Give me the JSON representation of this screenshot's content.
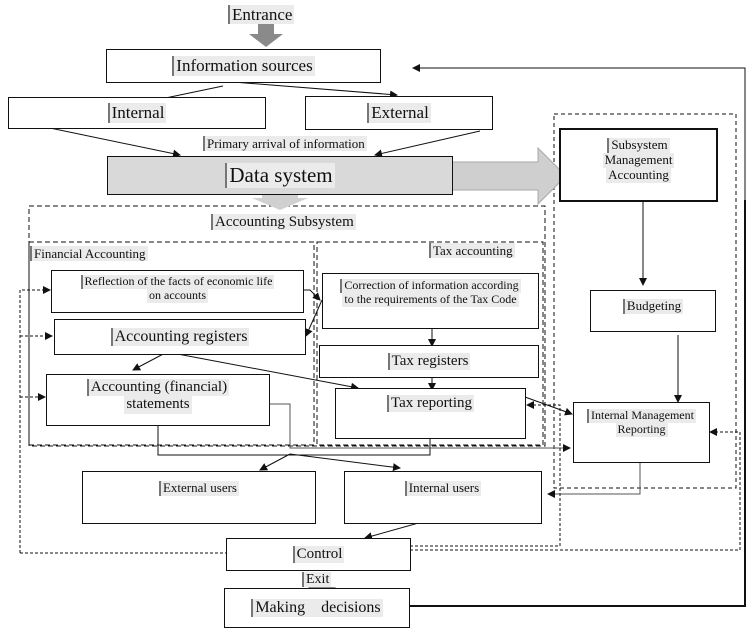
{
  "diagram": {
    "entrance": "Entrance",
    "information_sources": "Information sources",
    "internal": "Internal",
    "external": "External",
    "primary_arrival": "Primary arrival of information",
    "data_system": "Data system",
    "management_subsystem": [
      "Subsystem",
      "Management",
      "Accounting"
    ],
    "accounting_subsystem": "Accounting Subsystem",
    "financial_accounting": "Financial  Accounting",
    "tax_accounting": "Tax  accounting",
    "reflection": [
      "Reflection of the facts of economic life",
      "on accounts"
    ],
    "accounting_registers": "Accounting registers",
    "accounting_statements": [
      "Accounting (financial)",
      "statements"
    ],
    "correction": [
      "Correction of information according",
      "to the requirements of the Tax Code"
    ],
    "tax_registers": "Tax  registers",
    "tax_reporting": "Tax  reporting",
    "budgeting": "Budgeting",
    "internal_management_reporting": [
      "Internal Management",
      "Reporting"
    ],
    "external_users": "External users",
    "internal_users": "Internal users",
    "control": "Control",
    "exit": "Exit",
    "making_decisions": "Making    decisions"
  }
}
